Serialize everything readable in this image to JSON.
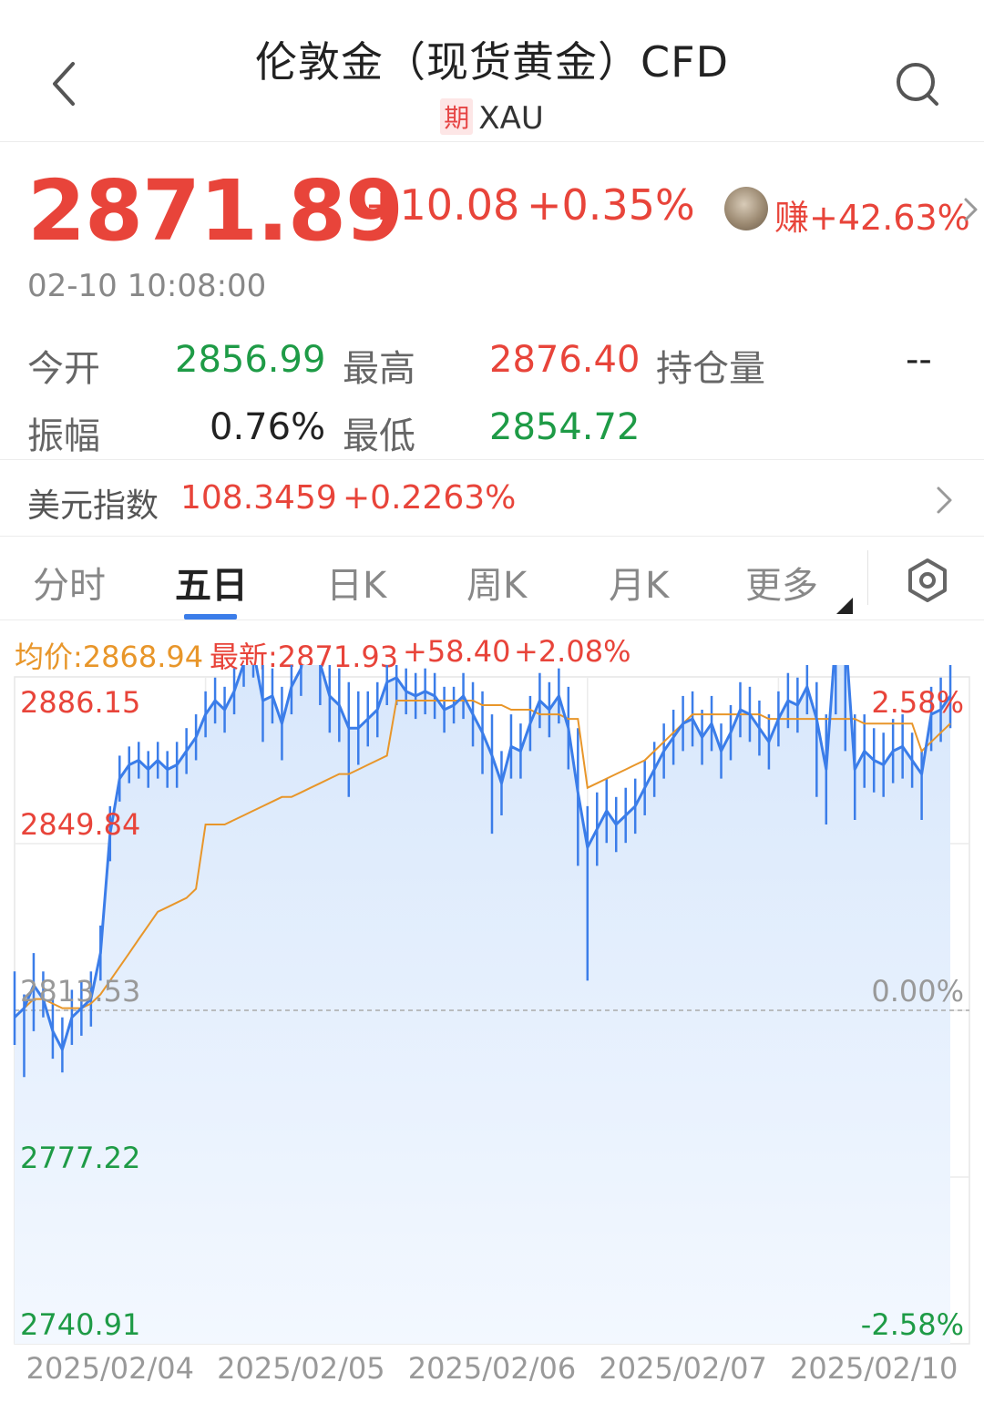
{
  "header": {
    "title": "伦敦金（现货黄金）CFD",
    "badge": "期",
    "code": "XAU"
  },
  "quote": {
    "price": "2871.89",
    "change": "+10.08",
    "change_pct": "+0.35%",
    "earn": "赚+42.63%",
    "time": "02-10 10:08:00",
    "open_label": "今开",
    "open": "2856.99",
    "high_label": "最高",
    "high": "2876.40",
    "oi_label": "持仓量",
    "oi": "--",
    "amp_label": "振幅",
    "amp": "0.76%",
    "low_label": "最低",
    "low": "2854.72"
  },
  "usd_index": {
    "label": "美元指数",
    "value": "108.3459",
    "change": "+0.2263%"
  },
  "tabs": [
    "分时",
    "五日",
    "日K",
    "周K",
    "月K",
    "更多"
  ],
  "active_tab": "五日",
  "legend": {
    "avg": "均价:2868.94",
    "latest": "最新:2871.93",
    "change": "+58.40",
    "pct": "+2.08%"
  },
  "colors": {
    "up": "#e8443a",
    "down": "#1e9b46",
    "price_line": "#3b7de9",
    "avg_line": "#e8962a"
  },
  "icons": {
    "back": "chevron-left-icon",
    "search": "search-icon",
    "settings": "settings-hexagon-icon"
  },
  "chart_data": {
    "type": "line",
    "x_labels": [
      "2025/02/04",
      "2025/02/05",
      "2025/02/06",
      "2025/02/07",
      "2025/02/10"
    ],
    "y_labels": [
      "2886.15",
      "2849.84",
      "2813.53",
      "2777.22",
      "2740.91"
    ],
    "pct_labels": [
      "2.58%",
      "0.00%",
      "-2.58%"
    ],
    "ylim": [
      2740.91,
      2886.15
    ],
    "prev_close": 2813.53,
    "series": [
      {
        "role": "price",
        "values": [
          2812,
          2814,
          2819,
          2816,
          2809,
          2805,
          2812,
          2814,
          2816,
          2826,
          2852,
          2864,
          2867,
          2868,
          2866,
          2868,
          2866,
          2867,
          2870,
          2873,
          2878,
          2881,
          2879,
          2883,
          2889,
          2892,
          2881,
          2882,
          2876,
          2884,
          2888,
          2900,
          2889,
          2882,
          2880,
          2875,
          2875,
          2877,
          2879,
          2885,
          2886,
          2883,
          2882,
          2883,
          2882,
          2879,
          2880,
          2882,
          2878,
          2874,
          2869,
          2863,
          2871,
          2870,
          2876,
          2881,
          2879,
          2882,
          2875,
          2861,
          2849,
          2853,
          2857,
          2854,
          2856,
          2858,
          2862,
          2866,
          2870,
          2873,
          2876,
          2877,
          2873,
          2876,
          2870,
          2874,
          2879,
          2878,
          2875,
          2872,
          2877,
          2881,
          2880,
          2884,
          2877,
          2866,
          2895,
          2896,
          2866,
          2870,
          2868,
          2867,
          2870,
          2871,
          2868,
          2865,
          2878,
          2879,
          2882
        ],
        "extent": [
          [
            2806,
            2822
          ],
          [
            2799,
            2817
          ],
          [
            2809,
            2826
          ],
          [
            2812,
            2822
          ],
          [
            2803,
            2816
          ],
          [
            2800,
            2812
          ],
          [
            2806,
            2818
          ],
          [
            2808,
            2820
          ],
          [
            2810,
            2822
          ],
          [
            2820,
            2832
          ],
          [
            2846,
            2858
          ],
          [
            2859,
            2869
          ],
          [
            2863,
            2871
          ],
          [
            2864,
            2872
          ],
          [
            2862,
            2870
          ],
          [
            2864,
            2872
          ],
          [
            2862,
            2870
          ],
          [
            2862,
            2872
          ],
          [
            2865,
            2875
          ],
          [
            2868,
            2878
          ],
          [
            2873,
            2883
          ],
          [
            2876,
            2886
          ],
          [
            2874,
            2884
          ],
          [
            2878,
            2888
          ],
          [
            2884,
            2894
          ],
          [
            2886,
            2900
          ],
          [
            2872,
            2890
          ],
          [
            2876,
            2888
          ],
          [
            2868,
            2884
          ],
          [
            2878,
            2890
          ],
          [
            2882,
            2898
          ],
          [
            2892,
            2910
          ],
          [
            2880,
            2898
          ],
          [
            2874,
            2890
          ],
          [
            2872,
            2888
          ],
          [
            2860,
            2885
          ],
          [
            2867,
            2883
          ],
          [
            2871,
            2883
          ],
          [
            2873,
            2885
          ],
          [
            2880,
            2890
          ],
          [
            2880,
            2892
          ],
          [
            2878,
            2888
          ],
          [
            2877,
            2887
          ],
          [
            2878,
            2888
          ],
          [
            2877,
            2887
          ],
          [
            2874,
            2884
          ],
          [
            2876,
            2884
          ],
          [
            2877,
            2887
          ],
          [
            2871,
            2885
          ],
          [
            2865,
            2883
          ],
          [
            2852,
            2878
          ],
          [
            2856,
            2870
          ],
          [
            2864,
            2878
          ],
          [
            2864,
            2876
          ],
          [
            2870,
            2882
          ],
          [
            2875,
            2887
          ],
          [
            2873,
            2885
          ],
          [
            2876,
            2888
          ],
          [
            2866,
            2884
          ],
          [
            2845,
            2875
          ],
          [
            2820,
            2858
          ],
          [
            2845,
            2861
          ],
          [
            2850,
            2864
          ],
          [
            2848,
            2860
          ],
          [
            2850,
            2862
          ],
          [
            2852,
            2864
          ],
          [
            2856,
            2868
          ],
          [
            2860,
            2872
          ],
          [
            2864,
            2876
          ],
          [
            2867,
            2879
          ],
          [
            2870,
            2882
          ],
          [
            2871,
            2883
          ],
          [
            2867,
            2879
          ],
          [
            2870,
            2882
          ],
          [
            2864,
            2876
          ],
          [
            2868,
            2880
          ],
          [
            2873,
            2885
          ],
          [
            2872,
            2884
          ],
          [
            2869,
            2881
          ],
          [
            2866,
            2878
          ],
          [
            2871,
            2883
          ],
          [
            2875,
            2887
          ],
          [
            2874,
            2886
          ],
          [
            2878,
            2890
          ],
          [
            2860,
            2885
          ],
          [
            2854,
            2878
          ],
          [
            2878,
            2912
          ],
          [
            2870,
            2900
          ],
          [
            2855,
            2878
          ],
          [
            2862,
            2878
          ],
          [
            2861,
            2875
          ],
          [
            2860,
            2874
          ],
          [
            2863,
            2877
          ],
          [
            2864,
            2878
          ],
          [
            2862,
            2874
          ],
          [
            2855,
            2870
          ],
          [
            2870,
            2884
          ],
          [
            2872,
            2886
          ],
          [
            2875,
            2889
          ]
        ]
      },
      {
        "role": "average",
        "values": [
          2812,
          2814,
          2816,
          2816,
          2815,
          2814,
          2814,
          2814,
          2815,
          2817,
          2820,
          2823,
          2826,
          2829,
          2832,
          2835,
          2836,
          2837,
          2838,
          2840,
          2854,
          2854,
          2854,
          2855,
          2856,
          2857,
          2858,
          2859,
          2860,
          2860,
          2861,
          2862,
          2863,
          2864,
          2865,
          2865,
          2866,
          2867,
          2868,
          2869,
          2881,
          2881,
          2881,
          2881,
          2881,
          2881,
          2881,
          2881,
          2881,
          2880,
          2880,
          2880,
          2879,
          2879,
          2879,
          2878,
          2878,
          2878,
          2877,
          2877,
          2862,
          2863,
          2864,
          2865,
          2866,
          2867,
          2868,
          2870,
          2872,
          2874,
          2876,
          2878,
          2878,
          2878,
          2878,
          2878,
          2878,
          2878,
          2878,
          2877,
          2877,
          2877,
          2877,
          2877,
          2877,
          2877,
          2877,
          2877,
          2877,
          2876,
          2876,
          2876,
          2876,
          2876,
          2876,
          2870,
          2872,
          2874,
          2876
        ]
      }
    ]
  }
}
